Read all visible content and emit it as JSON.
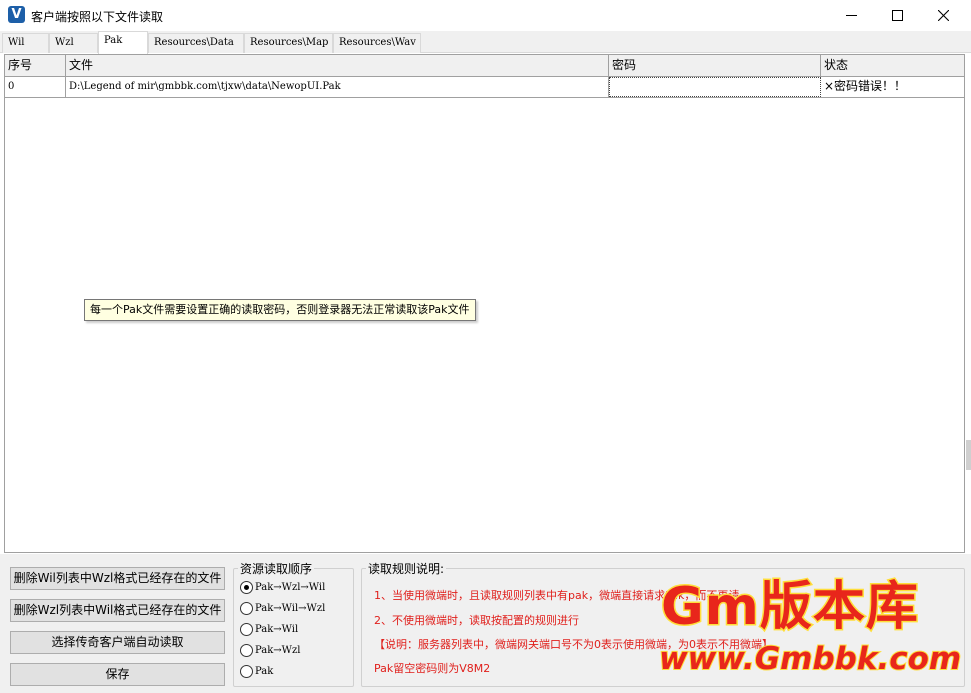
{
  "window": {
    "title": "客户端按照以下文件读取",
    "icon_letter": "V",
    "controls": [
      "minimize-icon",
      "maximize-icon",
      "close-icon"
    ]
  },
  "tabs": [
    {
      "label": "Wil",
      "active": false
    },
    {
      "label": "Wzl",
      "active": false
    },
    {
      "label": "Pak",
      "active": true
    },
    {
      "label": "Resources\\Data",
      "active": false
    },
    {
      "label": "Resources\\Map",
      "active": false
    },
    {
      "label": "Resources\\Wav",
      "active": false
    }
  ],
  "grid": {
    "columns": [
      "序号",
      "文件",
      "密码",
      "状态"
    ],
    "rows": [
      {
        "index": "0",
        "file": "D:\\Legend of mir\\gmbbk.com\\tjxw\\data\\NewopUI.Pak",
        "password": "",
        "status": "×密码错误！！"
      }
    ]
  },
  "tooltip": "每一个Pak文件需要设置正确的读取密码，否则登录器无法正常读取该Pak文件",
  "buttons": {
    "delete_wil": "删除Wil列表中Wzl格式已经存在的文件",
    "delete_wzl": "删除Wzl列表中Wil格式已经存在的文件",
    "auto_read": "选择传奇客户端自动读取",
    "save": "保存"
  },
  "read_order": {
    "title": "资源读取顺序",
    "options": [
      {
        "label": "Pak→Wzl→Wil",
        "selected": true
      },
      {
        "label": "Pak→Wil→Wzl",
        "selected": false
      },
      {
        "label": "Pak→Wil",
        "selected": false
      },
      {
        "label": "Pak→Wzl",
        "selected": false
      },
      {
        "label": "Pak",
        "selected": false
      }
    ]
  },
  "rules": {
    "title": "读取规则说明:",
    "lines": [
      "1、当使用微端时，且读取规则列表中有pak，微端直接请求Pak，而不再请",
      "2、不使用微端时，读取按配置的规则进行",
      "【说明：服务器列表中，微端网关端口号不为0表示使用微端，为0表示不用微端】",
      "Pak留空密码则为V8M2"
    ],
    "color": "#e0201c"
  },
  "watermark": {
    "top": "Gm版本库",
    "bottom": "www.Gmbbk.com"
  }
}
